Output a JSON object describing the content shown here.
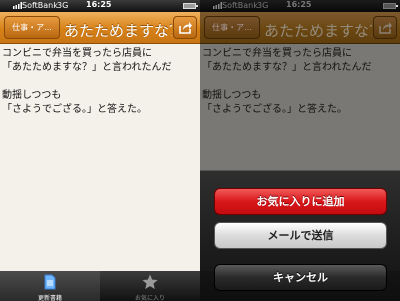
{
  "status": {
    "carrier": "SoftBank",
    "network": "3G",
    "time": "16:25"
  },
  "navbar": {
    "back_label": "仕事・ア...",
    "title": "あたためますな？"
  },
  "content": {
    "paragraphs": [
      "コンビニで弁当を買ったら店員に\n「あたためますな？」と言われたんだ",
      "動揺しつつも\n「さようでござる。」と答えた。"
    ]
  },
  "tabbar": {
    "tabs": [
      {
        "label": "更新書籍"
      },
      {
        "label": "お気に入り"
      }
    ]
  },
  "action_sheet": {
    "add_favorite_label": "お気に入りに追加",
    "send_mail_label": "メールで送信",
    "cancel_label": "キャンセル"
  },
  "colors": {
    "nav_orange": "#d68117",
    "destructive_red": "#d8171a"
  }
}
